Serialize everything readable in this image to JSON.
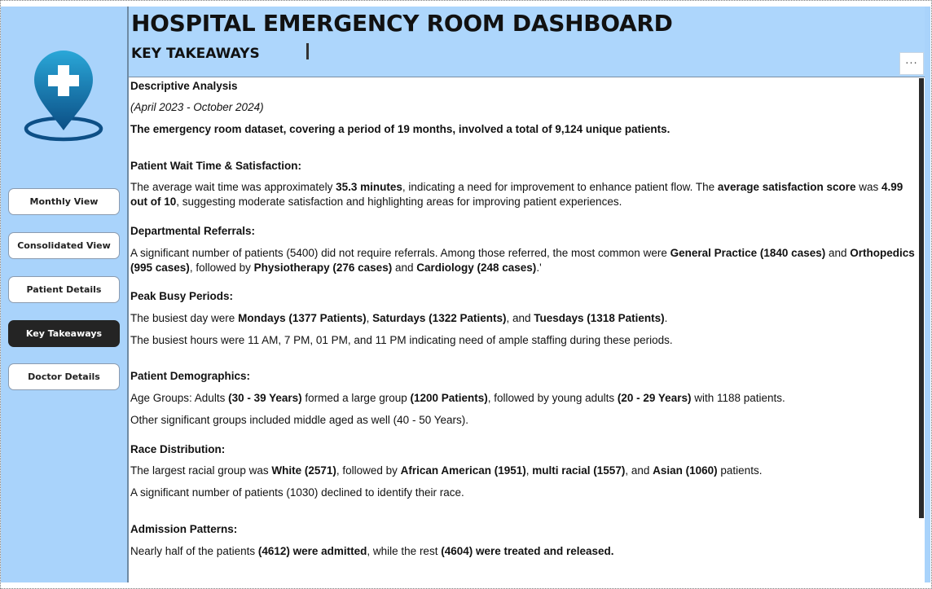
{
  "header": {
    "title": "HOSPITAL EMERGENCY ROOM DASHBOARD",
    "subtitle": "KEY TAKEAWAYS",
    "more_label": "···"
  },
  "sidebar": {
    "logo_icon": "hospital-location-pin-icon",
    "nav": [
      {
        "label": "Monthly View",
        "active": false
      },
      {
        "label": "Consolidated View",
        "active": false
      },
      {
        "label": "Patient Details",
        "active": false
      },
      {
        "label": "Key Takeaways",
        "active": true
      },
      {
        "label": "Doctor Details",
        "active": false
      }
    ]
  },
  "colors": {
    "sidebar_bg": "#a9d3fb",
    "header_bg": "#add6fc",
    "active_nav": "#242424",
    "logo_gradient_top": "#2aa7d8",
    "logo_gradient_bottom": "#0b4e85"
  },
  "content": {
    "descriptive": {
      "heading": "Descriptive Analysis",
      "period": "(April 2023 - October 2024)",
      "summary": "The emergency room dataset, covering a period of 19 months, involved a total of 9,124 unique patients."
    },
    "wait": {
      "heading": "Patient Wait Time & Satisfaction:",
      "p1": "The average wait time was approximately ",
      "b1": "35.3 minutes",
      "p2": ", indicating a need for improvement to enhance patient flow. The ",
      "b2": "average satisfaction score",
      "p3": " was ",
      "b3": "4.99 out of 10",
      "p4": ", suggesting moderate satisfaction and highlighting areas for improving patient experiences."
    },
    "referrals": {
      "heading": "Departmental Referrals:",
      "p1": "A significant number of patients (5400) did not require referrals. Among those referred, the most common were ",
      "b1": "General Practice (1840 cases)",
      "p2": " and ",
      "b2": "Orthopedics (995 cases)",
      "p3": ", followed by ",
      "b3": "Physiotherapy (276 cases)",
      "p4": " and ",
      "b4": "Cardiology (248 cases)",
      "p5": ".'"
    },
    "peak": {
      "heading": "Peak Busy Periods:",
      "p1": "The busiest day were ",
      "b1": "Mondays (1377 Patients)",
      "p2": ", ",
      "b2": "Saturdays (1322 Patients)",
      "p3": ", and ",
      "b3": "Tuesdays (1318 Patients)",
      "p4": ".",
      "hours": "The busiest hours were 11 AM, 7 PM, 01 PM, and 11 PM indicating need of ample staffing during these periods."
    },
    "demographics": {
      "heading": "Patient Demographics:",
      "p1": "Age Groups: Adults ",
      "b1": "(30 - 39 Years)",
      "p2": " formed a large group ",
      "b2": "(1200 Patients)",
      "p3": ", followed by young adults ",
      "b3": "(20 - 29 Years)",
      "p4": " with 1188 patients.",
      "other": "Other significant groups included middle aged as well (40 - 50 Years)."
    },
    "race": {
      "heading": "Race Distribution:",
      "p1": "The largest racial group was ",
      "b1": "White (2571)",
      "p2": ", followed by ",
      "b2": "African American (1951)",
      "p3": ", ",
      "b3": "multi racial (1557)",
      "p4": ", and ",
      "b4": "Asian (1060)",
      "p5": " patients.",
      "declined": "A significant number of patients (1030) declined to identify their race."
    },
    "admission": {
      "heading": "Admission Patterns:",
      "p1": "Nearly half of the patients ",
      "b1": "(4612) were admitted",
      "p2": ", while the rest ",
      "b2": "(4604) were treated and released."
    }
  }
}
